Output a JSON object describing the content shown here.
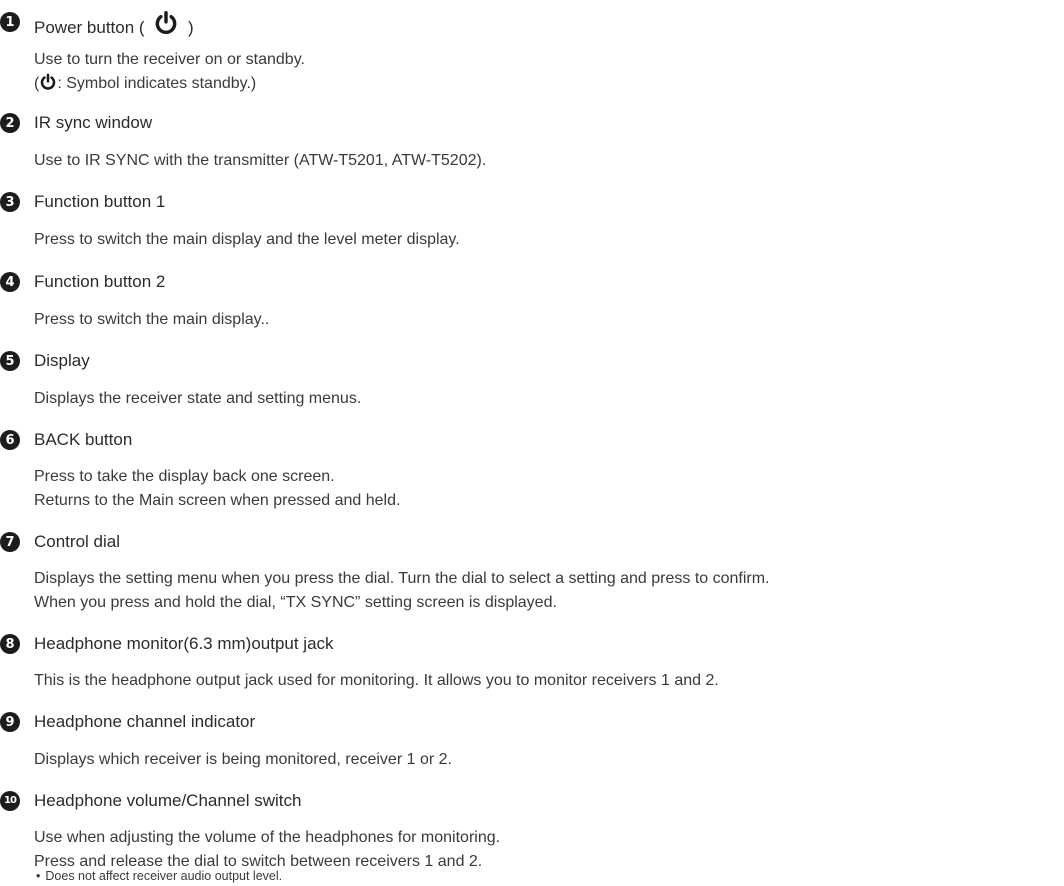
{
  "items": [
    {
      "number": "1",
      "title_prefix": "Power button (",
      "title_suffix": ")",
      "lines": [
        "Use to turn the receiver on or standby."
      ],
      "note_suffix": ": Symbol indicates standby.)",
      "note_prefix": "("
    },
    {
      "number": "2",
      "title": "IR sync window",
      "lines": [
        "Use to IR SYNC with the transmitter (ATW-T5201, ATW-T5202)."
      ]
    },
    {
      "number": "3",
      "title": "Function button 1",
      "lines": [
        "Press to switch the main display and the level meter display."
      ]
    },
    {
      "number": "4",
      "title": "Function button 2",
      "lines": [
        "Press to switch the main display.."
      ]
    },
    {
      "number": "5",
      "title": "Display",
      "lines": [
        "Displays the receiver state and setting menus."
      ]
    },
    {
      "number": "6",
      "title": "BACK button",
      "lines": [
        "Press to take the display back one screen.",
        "Returns to the Main screen when pressed and held."
      ]
    },
    {
      "number": "7",
      "title": "Control dial",
      "lines": [
        "Displays the setting menu when you press the dial. Turn the dial to select a setting and press to confirm.",
        "When you press and hold the dial, “TX SYNC” setting screen is displayed."
      ]
    },
    {
      "number": "8",
      "title": "Headphone monitor(6.3 mm)output jack",
      "lines": [
        "This is the headphone output jack used for monitoring. It allows you to monitor receivers 1 and 2."
      ]
    },
    {
      "number": "9",
      "title": "Headphone channel indicator",
      "lines": [
        "Displays which receiver is being monitored, receiver 1 or 2."
      ]
    },
    {
      "number": "10",
      "title": "Headphone volume/Channel switch",
      "lines": [
        "Use when adjusting the volume of the headphones for monitoring.",
        "Press and release the dial to switch between receivers 1 and 2."
      ],
      "bullet": "Does not affect receiver audio output level."
    }
  ]
}
